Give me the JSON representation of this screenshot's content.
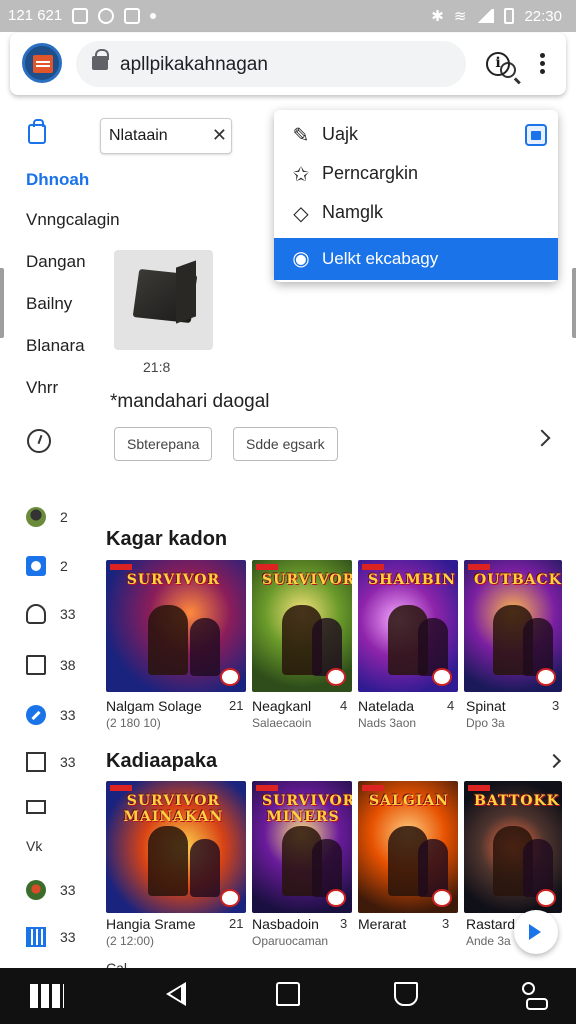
{
  "status_bar": {
    "left_text": "121 621",
    "time": "22:30"
  },
  "browser": {
    "url": "apllpikakahnagan"
  },
  "search_chip": {
    "value": "Nlataain"
  },
  "dropdown": {
    "items": [
      {
        "icon": "pencil-icon",
        "label": "Uajk"
      },
      {
        "icon": "sparkle-icon",
        "label": "Perncargkin"
      },
      {
        "icon": "tag-icon",
        "label": "Namglk"
      },
      {
        "icon": "globe-icon",
        "label": "Uelkt ekcabagy",
        "selected": true
      }
    ]
  },
  "sidebar": {
    "items": [
      {
        "label": "Dhnoah",
        "active": true
      },
      {
        "label": "Vnngcalagin"
      },
      {
        "label": "Dangan"
      },
      {
        "label": "Bailny"
      },
      {
        "label": "Blanara"
      },
      {
        "label": "Vhrr"
      }
    ],
    "rows": [
      {
        "icon": "avatar-icon",
        "value": "2"
      },
      {
        "icon": "clipboard-icon",
        "value": "2"
      },
      {
        "icon": "bell-icon",
        "value": "33"
      },
      {
        "icon": "folder-icon",
        "value": "38"
      },
      {
        "icon": "pen-icon",
        "value": "33"
      },
      {
        "icon": "box-icon",
        "value": "33"
      },
      {
        "icon": "box-icon",
        "value": ""
      },
      {
        "icon": "text",
        "value": "Vk"
      },
      {
        "icon": "avatar-icon",
        "value": "33"
      },
      {
        "icon": "grid-icon",
        "value": "33"
      }
    ]
  },
  "product": {
    "caption": "21:8",
    "title": "*mandahari daogal",
    "chips": [
      "Sbterepana",
      "Sdde egsark"
    ]
  },
  "sections": [
    {
      "title": "Kagar kadon",
      "games": [
        {
          "cover_title": "SURVIVOR",
          "name": "Nalgam Solage",
          "num": "21",
          "sub": "(2 180 10)"
        },
        {
          "cover_title": "SURVIVORS",
          "name": "Neagkanl",
          "num": "4",
          "sub": "Salaecaoin"
        },
        {
          "cover_title": "SHAMBIN",
          "name": "Natelada",
          "num": "4",
          "sub": "Nads 3aon"
        },
        {
          "cover_title": "OUTBACKS",
          "name": "Spinat",
          "num": "3",
          "sub": "Dpo 3a"
        }
      ]
    },
    {
      "title": "Kadiaapaka",
      "games": [
        {
          "cover_title": "SURVIVOR MAINAKAN",
          "name": "Hangia Srame",
          "num": "21",
          "sub": "(2 12:00)"
        },
        {
          "cover_title": "SURVIVOR MINERS",
          "name": "Nasbadoin",
          "num": "3",
          "sub": "Oparuocaman"
        },
        {
          "cover_title": "SALGIAN",
          "name": "Merarat",
          "num": "3",
          "sub": ""
        },
        {
          "cover_title": "BATTOKK",
          "name": "Rastard",
          "num": "",
          "sub": "Ande 3a"
        }
      ]
    }
  ],
  "peek_text": "Cal",
  "colors": {
    "accent": "#1a73e8",
    "status_bar": "#bdbdbd",
    "nav_bar": "#111111"
  }
}
